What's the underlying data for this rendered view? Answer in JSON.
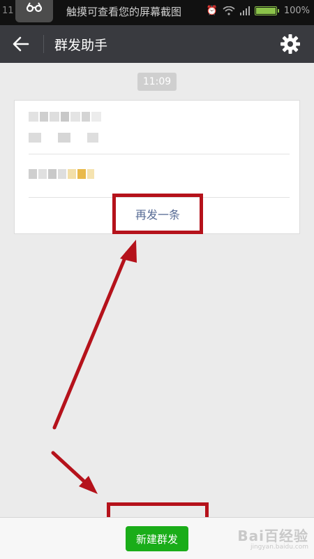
{
  "status_bar": {
    "left_time": "11",
    "notification": "触摸可查看您的屏幕截图",
    "battery_percent": "100%"
  },
  "header": {
    "title": "群发助手",
    "back_icon": "arrow-left-icon",
    "settings_icon": "gear-icon"
  },
  "chat": {
    "timestamp": "11:09",
    "resend_label": "再发一条"
  },
  "bottom_bar": {
    "new_broadcast_label": "新建群发"
  },
  "watermark": {
    "main": "Bai百经验",
    "sub": "jingyan.baidu.com"
  },
  "colors": {
    "header_bg": "#393a3f",
    "accent_green": "#1aad19",
    "link_blue": "#576b95",
    "annotation_red": "#b5121b"
  }
}
